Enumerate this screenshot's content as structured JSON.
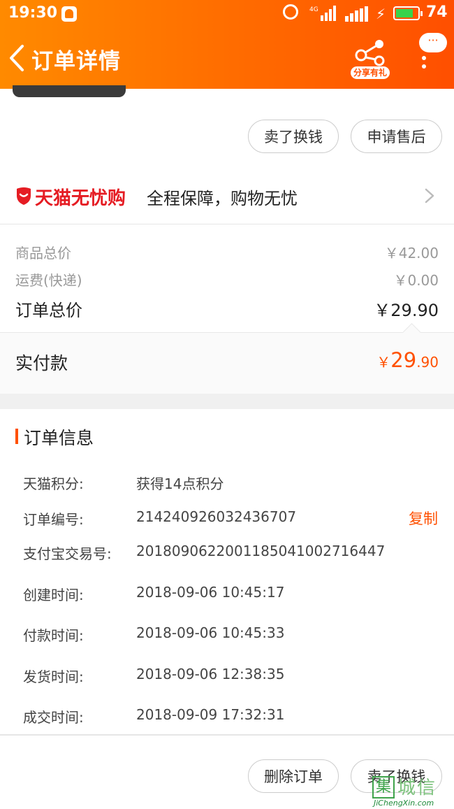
{
  "status_bar": {
    "time": "19:30",
    "network": "4G",
    "battery": "74",
    "battery_level": 0.74
  },
  "header": {
    "title": "订单详情",
    "share_label": "分享有礼",
    "more_label": "···"
  },
  "top_actions": {
    "sell_label": "卖了换钱",
    "after_sales_label": "申请售后"
  },
  "guarantee": {
    "brand": "天猫无忧购",
    "text": "全程保障，购物无忧"
  },
  "price_summary": {
    "goods_total_label": "商品总价",
    "goods_total_value": "￥42.00",
    "shipping_label": "运费(快递)",
    "shipping_value": "￥0.00",
    "order_total_label": "订单总价",
    "order_total_value": "￥29.90",
    "paid_label": "实付款",
    "paid_currency": "￥",
    "paid_int": "29",
    "paid_dec": ".90"
  },
  "order_info": {
    "title": "订单信息",
    "copy_label": "复制",
    "rows": [
      {
        "key": "天猫积分:",
        "value": "获得14点积分"
      },
      {
        "key": "订单编号:",
        "value": "214240926032436707"
      },
      {
        "key": "支付宝交易号:",
        "value": "2018090622001185041002716447"
      },
      {
        "key": "创建时间:",
        "value": "2018-09-06 10:45:17"
      },
      {
        "key": "付款时间:",
        "value": "2018-09-06 10:45:33"
      },
      {
        "key": "发货时间:",
        "value": "2018-09-06 12:38:35"
      },
      {
        "key": "成交时间:",
        "value": "2018-09-09 17:32:31"
      }
    ]
  },
  "bottom_actions": {
    "delete_label": "删除订单",
    "sell_label": "卖了换钱"
  },
  "watermark": {
    "cn": "城信",
    "box": "集",
    "en": "JiChengXin.com"
  },
  "colors": {
    "accent": "#ff5000",
    "brand_red": "#e51c23"
  }
}
